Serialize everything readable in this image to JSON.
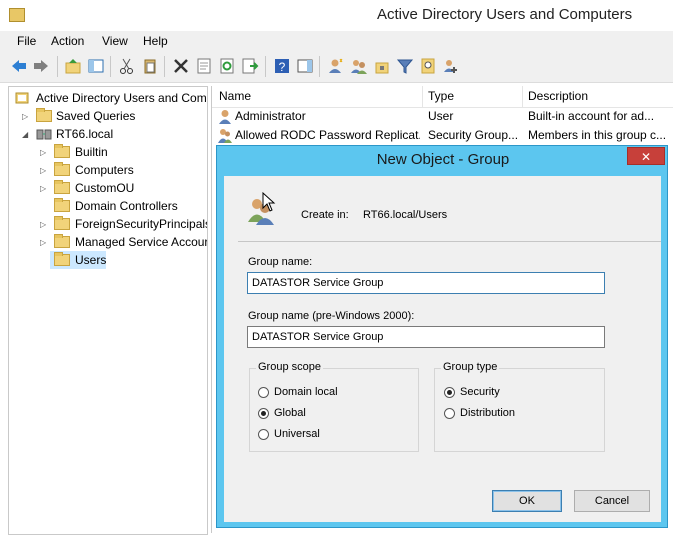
{
  "window": {
    "title": "Active Directory Users and Computers"
  },
  "menu": [
    "File",
    "Action",
    "View",
    "Help"
  ],
  "tree": {
    "root": "Active Directory Users and Com",
    "items": [
      {
        "label": "Saved Queries"
      },
      {
        "label": "RT66.local"
      },
      {
        "label": "Builtin"
      },
      {
        "label": "Computers"
      },
      {
        "label": "CustomOU"
      },
      {
        "label": "Domain Controllers"
      },
      {
        "label": "ForeignSecurityPrincipals"
      },
      {
        "label": "Managed Service Accour"
      },
      {
        "label": "Users"
      }
    ]
  },
  "list": {
    "columns": [
      "Name",
      "Type",
      "Description"
    ],
    "rows": [
      {
        "name": "Administrator",
        "type": "User",
        "description": "Built-in account for ad..."
      },
      {
        "name": "Allowed RODC Password Replicat...",
        "type": "Security Group...",
        "description": "Members in this group c..."
      }
    ]
  },
  "dialog": {
    "title": "New Object - Group",
    "close": "✕",
    "create_in_label": "Create in:",
    "create_in_value": "RT66.local/Users",
    "group_name_label": "Group name:",
    "group_name_value": "DATASTOR Service Group",
    "group_name_pre2000_label": "Group name (pre-Windows 2000):",
    "group_name_pre2000_value": "DATASTOR Service Group",
    "scope": {
      "title": "Group scope",
      "options": [
        "Domain local",
        "Global",
        "Universal"
      ],
      "selected": "Global"
    },
    "type": {
      "title": "Group type",
      "options": [
        "Security",
        "Distribution"
      ],
      "selected": "Security"
    },
    "ok_label": "OK",
    "cancel_label": "Cancel"
  }
}
